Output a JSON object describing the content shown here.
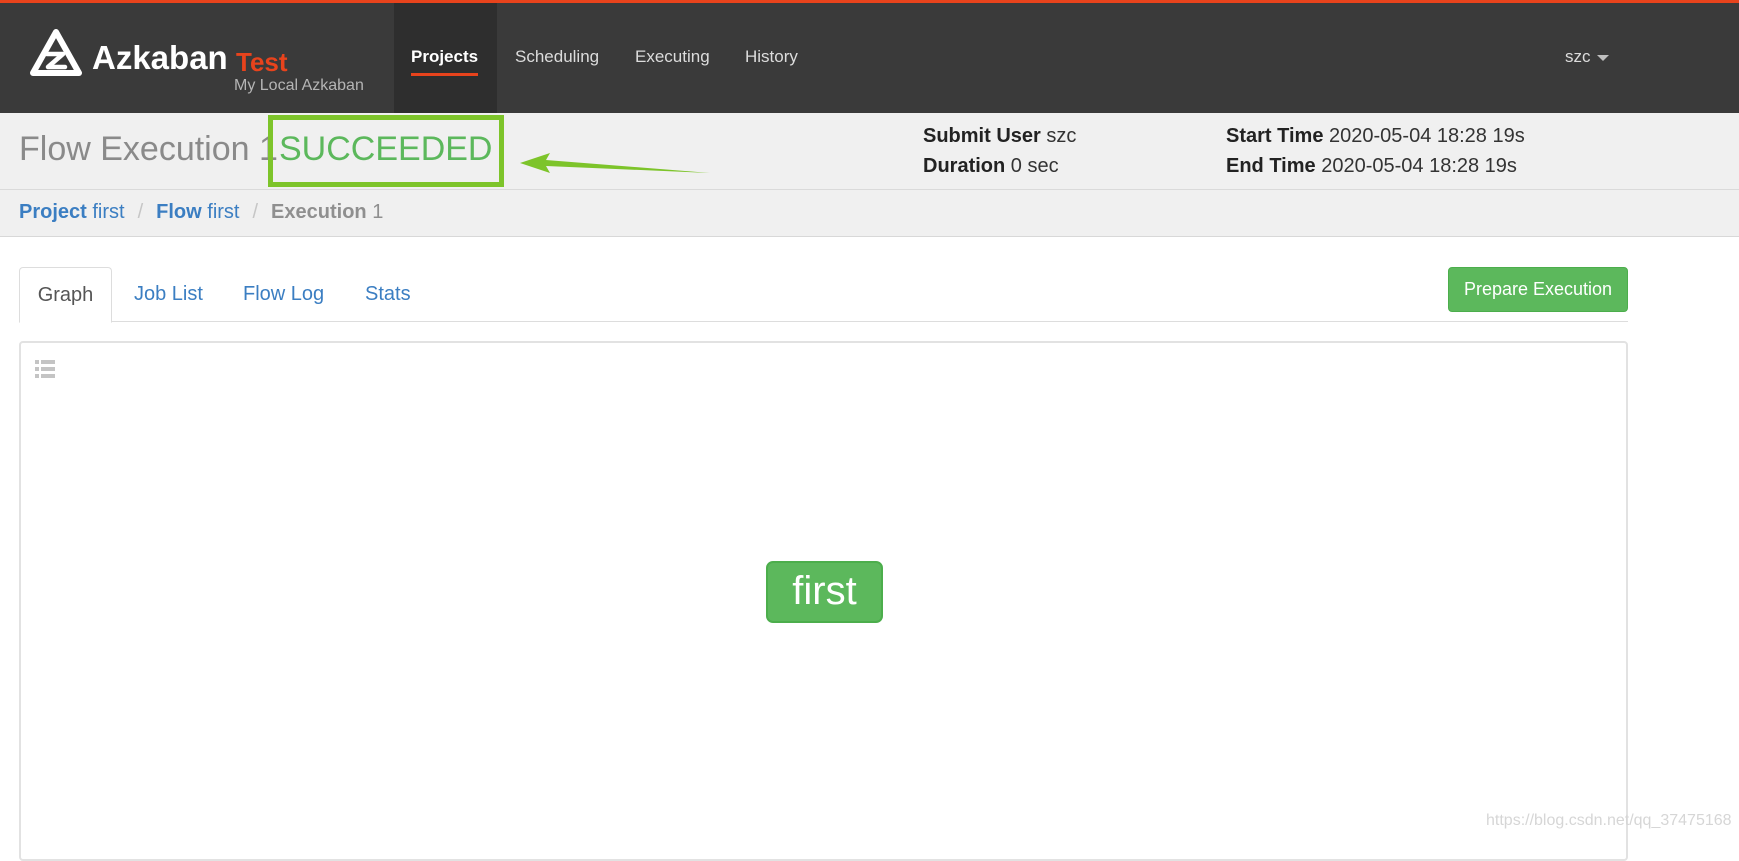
{
  "navbar": {
    "brand": "Azkaban",
    "environment": "Test",
    "subtitle": "My Local Azkaban",
    "items": [
      {
        "label": "Projects",
        "active": true
      },
      {
        "label": "Scheduling",
        "active": false
      },
      {
        "label": "Executing",
        "active": false
      },
      {
        "label": "History",
        "active": false
      }
    ],
    "user": "szc",
    "icons": {
      "logo": "azkaban-logo-icon",
      "dropdown": "caret-down-icon"
    },
    "accent_color": "#e8431c"
  },
  "header": {
    "title": "Flow Execution 1",
    "status": "SUCCEEDED",
    "status_color": "#5cb85c",
    "highlight_color": "#7dc42a",
    "submit_user_label": "Submit User",
    "submit_user": "szc",
    "duration_label": "Duration",
    "duration": "0 sec",
    "start_time_label": "Start Time",
    "start_time": "2020-05-04 18:28 19s",
    "end_time_label": "End Time",
    "end_time": "2020-05-04 18:28 19s"
  },
  "breadcrumb": {
    "project_label": "Project",
    "project": "first",
    "flow_label": "Flow",
    "flow": "first",
    "execution_label": "Execution",
    "execution": "1",
    "separator": "/"
  },
  "tabs": [
    {
      "label": "Graph",
      "active": true
    },
    {
      "label": "Job List",
      "active": false
    },
    {
      "label": "Flow Log",
      "active": false
    },
    {
      "label": "Stats",
      "active": false
    }
  ],
  "actions": {
    "prepare_execution": "Prepare Execution"
  },
  "graph": {
    "toggle_icon": "list-icon",
    "nodes": [
      {
        "label": "first",
        "status": "SUCCEEDED"
      }
    ]
  },
  "watermark": "https://blog.csdn.net/qq_37475168"
}
